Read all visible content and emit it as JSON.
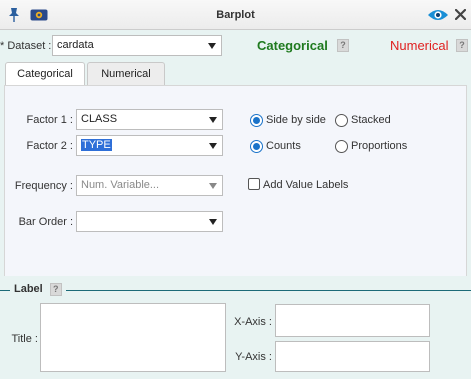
{
  "window": {
    "title": "Barplot",
    "icons": [
      "pin-icon",
      "rcode-icon",
      "eye-icon",
      "close-icon"
    ]
  },
  "dataset": {
    "label": "* Dataset :",
    "value": "cardata"
  },
  "mode": {
    "categorical_label": "Categorical",
    "numerical_label": "Numerical",
    "categorical_color": "#1f7a1f",
    "numerical_color": "#e02020",
    "help": "?"
  },
  "tabs": [
    {
      "label": "Categorical",
      "active": true
    },
    {
      "label": "Numerical",
      "active": false
    }
  ],
  "form": {
    "factor1_label": "Factor 1 :",
    "factor1_value": "CLASS",
    "factor2_label": "Factor 2 :",
    "factor2_value": "TYPE",
    "frequency_label": "Frequency :",
    "frequency_placeholder": "Num. Variable...",
    "bar_order_label": "Bar Order :",
    "bar_order_value": "",
    "layout_options": [
      {
        "label": "Side by side",
        "selected": true
      },
      {
        "label": "Stacked",
        "selected": false
      }
    ],
    "scale_options": [
      {
        "label": "Counts",
        "selected": true
      },
      {
        "label": "Proportions",
        "selected": false
      }
    ],
    "value_labels_checkbox": {
      "label": "Add Value Labels",
      "checked": false
    }
  },
  "label_section": {
    "legend": "Label",
    "help": "?",
    "title_label": "Title :",
    "xaxis_label": "X-Axis :",
    "yaxis_label": "Y-Axis :"
  }
}
